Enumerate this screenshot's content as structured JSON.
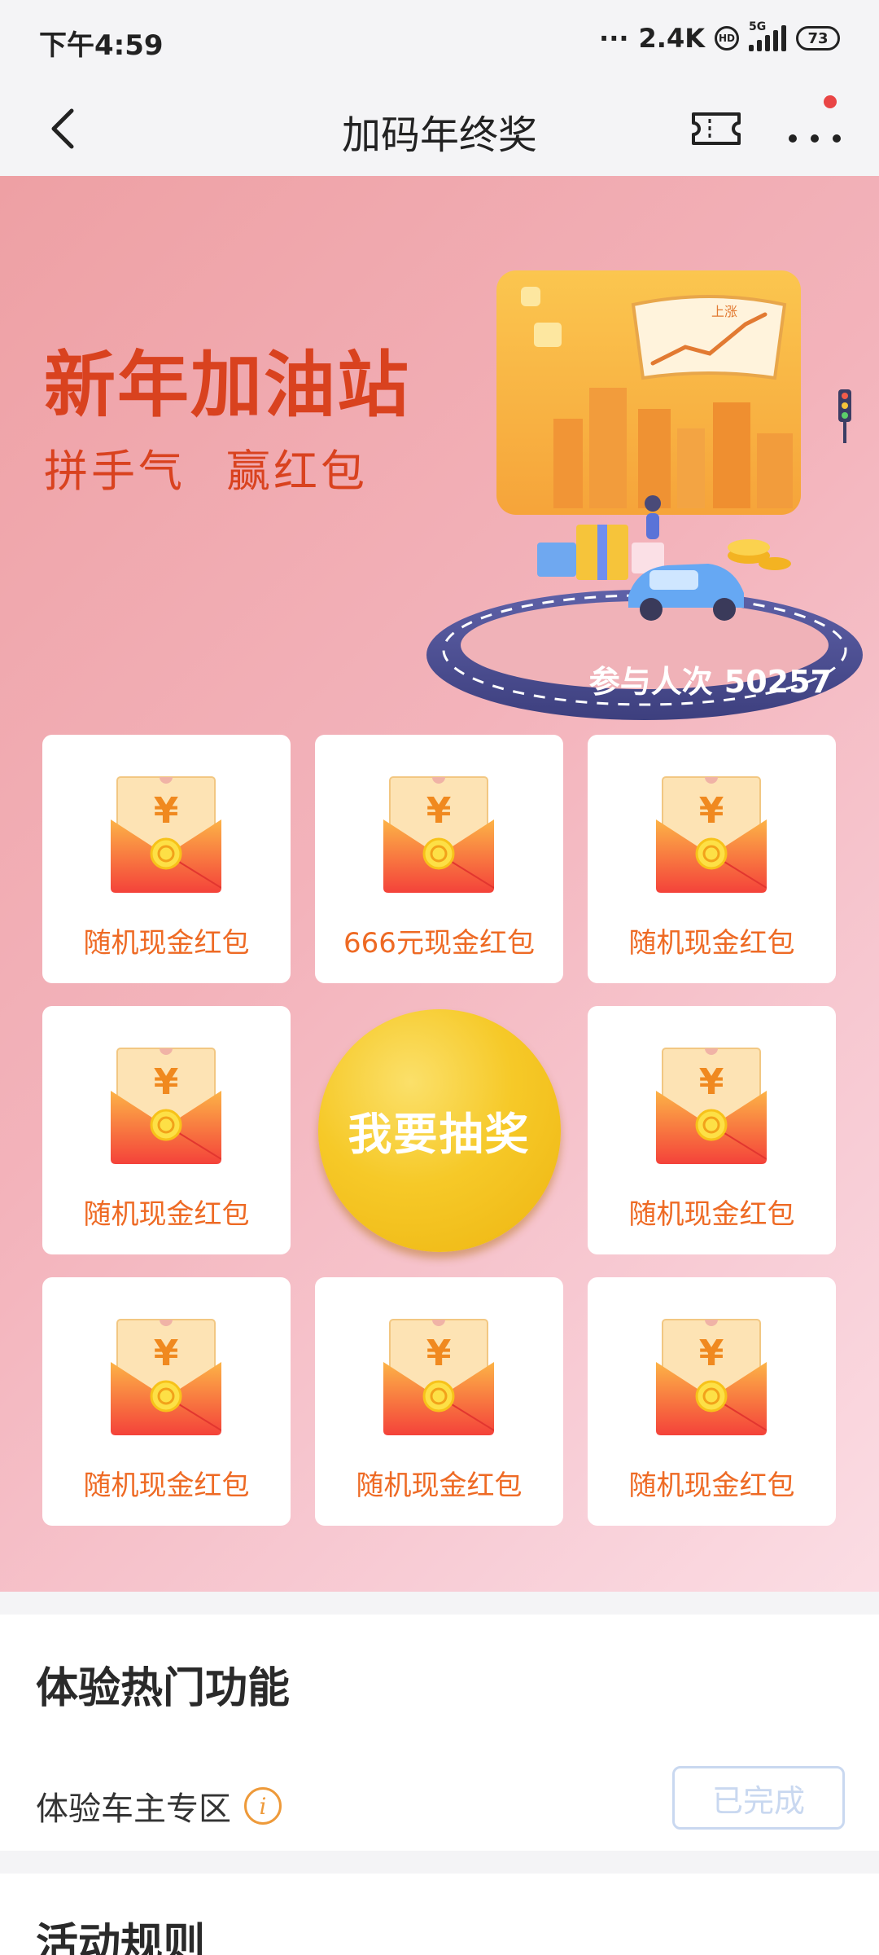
{
  "status_bar": {
    "time": "下午4:59",
    "dots": "···",
    "net_speed": "2.4K",
    "hd": "HD",
    "network": "5G",
    "battery": "73"
  },
  "nav": {
    "title": "加码年终奖",
    "back_icon": "chevron-left-icon",
    "ticket_icon": "ticket-icon",
    "more_icon": "more-dots-icon"
  },
  "banner": {
    "title": "新年加油站",
    "subtitle": [
      "拼手气",
      "赢红包"
    ],
    "illustration_badge": "上涨",
    "participants_label": "参与人次",
    "participants_count": "50257"
  },
  "prizes": [
    {
      "label": "随机现金红包"
    },
    {
      "label": "666元现金红包"
    },
    {
      "label": "随机现金红包"
    },
    {
      "label": "随机现金红包"
    },
    {
      "label": "随机现金红包"
    },
    {
      "label": "随机现金红包"
    },
    {
      "label": "随机现金红包"
    },
    {
      "label": "随机现金红包"
    }
  ],
  "draw_button": "我要抽奖",
  "features": {
    "title": "体验热门功能",
    "item_label": "体验车主专区",
    "info_icon": "i",
    "status_button": "已完成"
  },
  "rules": {
    "title": "活动规则"
  },
  "colors": {
    "accent": "#d9421f",
    "prize_label": "#ee6a24",
    "draw_button": "#f6c928",
    "info_icon": "#ee9a3a"
  }
}
